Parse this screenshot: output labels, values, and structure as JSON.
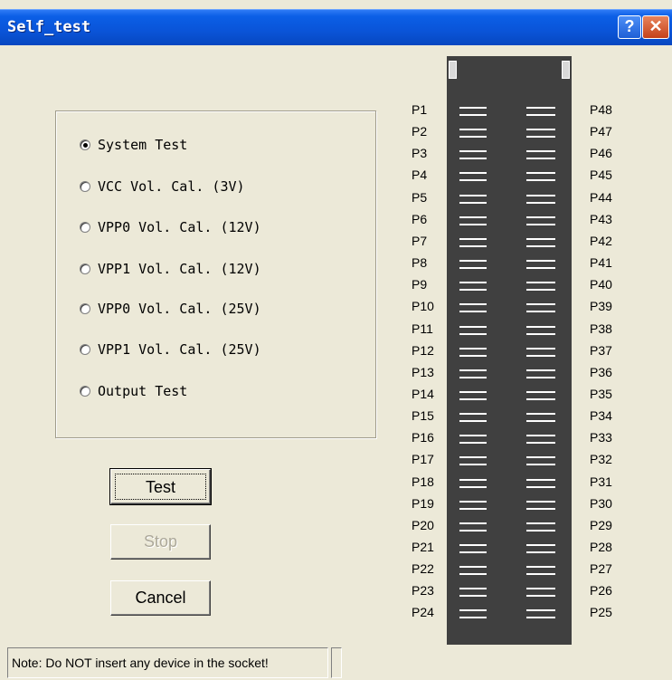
{
  "window": {
    "title": "Self_test",
    "help_label": "?",
    "close_label": "✕"
  },
  "options": [
    {
      "label": "System Test",
      "checked": true
    },
    {
      "label": "VCC Vol. Cal. (3V)",
      "checked": false
    },
    {
      "label": "VPP0 Vol. Cal. (12V)",
      "checked": false
    },
    {
      "label": "VPP1 Vol. Cal. (12V)",
      "checked": false
    },
    {
      "label": "VPP0 Vol. Cal. (25V)",
      "checked": false
    },
    {
      "label": "VPP1 Vol. Cal. (25V)",
      "checked": false
    },
    {
      "label": "Output Test",
      "checked": false
    }
  ],
  "buttons": {
    "test": "Test",
    "stop": "Stop",
    "cancel": "Cancel"
  },
  "pins_left": [
    "P1",
    "P2",
    "P3",
    "P4",
    "P5",
    "P6",
    "P7",
    "P8",
    "P9",
    "P10",
    "P11",
    "P12",
    "P13",
    "P14",
    "P15",
    "P16",
    "P17",
    "P18",
    "P19",
    "P20",
    "P21",
    "P22",
    "P23",
    "P24"
  ],
  "pins_right": [
    "P48",
    "P47",
    "P46",
    "P45",
    "P44",
    "P43",
    "P42",
    "P41",
    "P40",
    "P39",
    "P38",
    "P37",
    "P36",
    "P35",
    "P34",
    "P33",
    "P32",
    "P31",
    "P30",
    "P29",
    "P28",
    "P27",
    "P26",
    "P25"
  ],
  "status": {
    "note": "Note: Do NOT insert any device in the socket!"
  }
}
